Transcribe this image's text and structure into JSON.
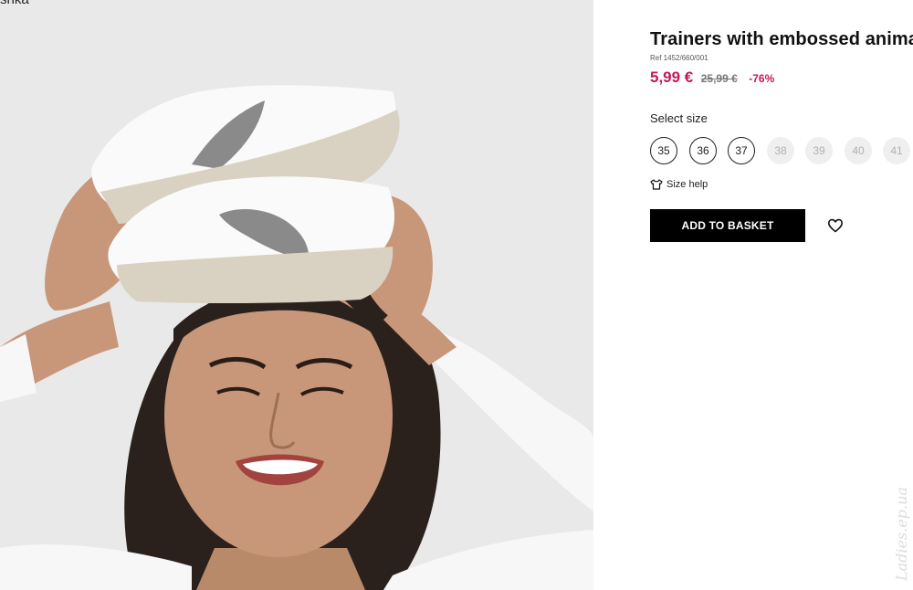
{
  "image": {
    "alt_text": "shka"
  },
  "product": {
    "title": "Trainers with embossed animal pr",
    "ref": "Ref 1452/660/001",
    "price_now": "5,99 €",
    "price_old": "25,99 €",
    "discount": "-76%"
  },
  "sizes": {
    "label": "Select size",
    "options": [
      {
        "label": "35",
        "available": true
      },
      {
        "label": "36",
        "available": true
      },
      {
        "label": "37",
        "available": true
      },
      {
        "label": "38",
        "available": false
      },
      {
        "label": "39",
        "available": false
      },
      {
        "label": "40",
        "available": false
      },
      {
        "label": "41",
        "available": false
      }
    ],
    "help_label": "Size help",
    "help_icon": "tshirt-icon"
  },
  "actions": {
    "basket_label": "ADD TO BASKET",
    "wishlist_icon": "heart-icon"
  },
  "watermark": "Ladies.ep.ua",
  "colors": {
    "price_accent": "#c2185b",
    "button_bg": "#000000",
    "photo_bg": "#e9e9e9"
  }
}
